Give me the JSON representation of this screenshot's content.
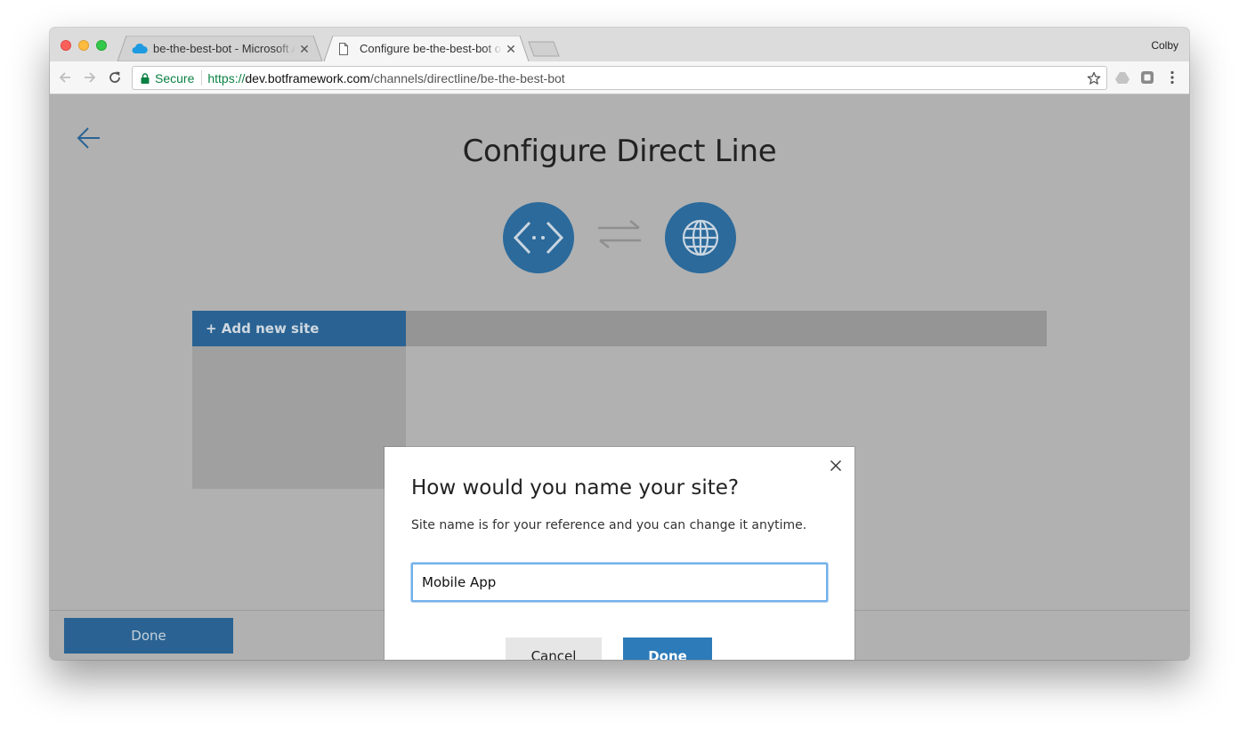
{
  "browser": {
    "tabs": [
      {
        "title": "be-the-best-bot - Microsoft Azure",
        "icon": "azure-cloud-icon",
        "active": false
      },
      {
        "title": "Configure be-the-best-bot on",
        "icon": "document-icon",
        "active": true
      }
    ],
    "profile_name": "Colby",
    "secure_label": "Secure",
    "url": {
      "scheme": "https://",
      "host": "dev.botframework.com",
      "path": "/channels/directline/be-the-best-bot"
    }
  },
  "page": {
    "title": "Configure Direct Line",
    "add_site_label": "+ Add new site",
    "footer_done_label": "Done"
  },
  "dialog": {
    "title": "How would you name your site?",
    "description": "Site name is for your reference and you can change it anytime.",
    "input_value": "Mobile App",
    "cancel_label": "Cancel",
    "done_label": "Done"
  },
  "colors": {
    "accent": "#2d7bb9",
    "page_overlay": "#b1b1b1",
    "secure_green": "#0b8043"
  }
}
